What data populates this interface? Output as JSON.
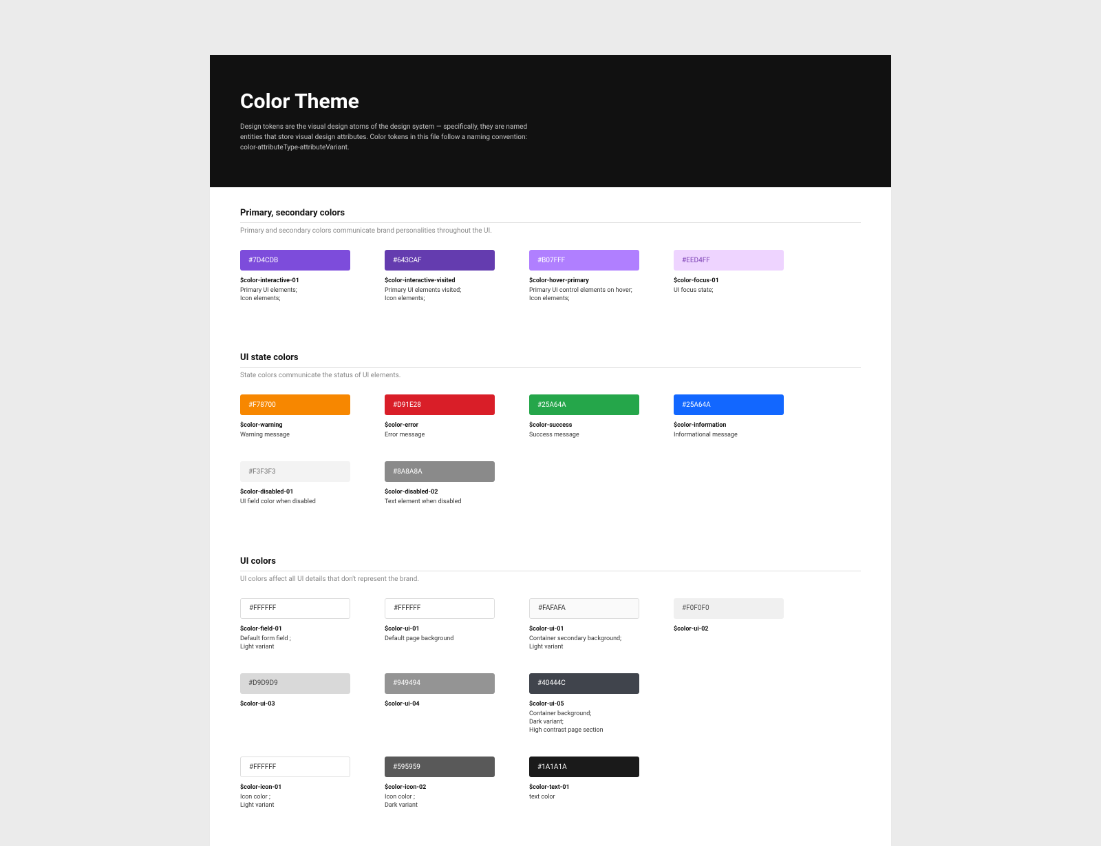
{
  "header": {
    "title": "Color Theme",
    "subtitle": "Design tokens are the visual design atoms of the design system — specifically, they are named entities that store visual design attributes. Color tokens in this file follow a naming convention: color-attributeType-attributeVariant."
  },
  "sections": [
    {
      "title": "Primary, secondary colors",
      "subtitle": "Primary and secondary colors communicate brand personalities throughout the UI.",
      "swatches": [
        {
          "hex": "#7D4CDB",
          "bg": "#7D4CDB",
          "txt": "#ffffff",
          "name": "$color-interactive-01",
          "desc": "Primary UI elements;\nIcon elements;"
        },
        {
          "hex": "#643CAF",
          "bg": "#643CAF",
          "txt": "#ffffff",
          "name": "$color-interactive-visited",
          "desc": "Primary UI elements visited;\nIcon elements;"
        },
        {
          "hex": "#B07FFF",
          "bg": "#B07FFF",
          "txt": "#ffffff",
          "name": "$color-hover-primary",
          "desc": "Primary UI control elements on hover;\nIcon elements;"
        },
        {
          "hex": "#EED4FF",
          "bg": "#EED4FF",
          "txt": "#7a3fb3",
          "name": "$color-focus-01",
          "desc": "UI focus state;"
        }
      ]
    },
    {
      "title": "UI state colors",
      "subtitle": "State colors communicate the status of UI elements.",
      "swatches": [
        {
          "hex": "#F78700",
          "bg": "#F78700",
          "txt": "#ffffff",
          "name": "$color-warning",
          "desc": "Warning message"
        },
        {
          "hex": "#D91E28",
          "bg": "#D91E28",
          "txt": "#ffffff",
          "name": "$color-error",
          "desc": "Error message"
        },
        {
          "hex": "#25A64A",
          "bg": "#25A64A",
          "txt": "#ffffff",
          "name": "$color-success",
          "desc": "Success message"
        },
        {
          "hex": "#25A64A",
          "bg": "#1267ff",
          "txt": "#ffffff",
          "name": "$color-information",
          "desc": "Informational message"
        },
        {
          "hex": "#F3F3F3",
          "bg": "#F3F3F3",
          "txt": "#777777",
          "name": "$color-disabled-01",
          "desc": "UI field color when disabled"
        },
        {
          "hex": "#8A8A8A",
          "bg": "#8A8A8A",
          "txt": "#ffffff",
          "name": "$color-disabled-02",
          "desc": "Text element when disabled"
        }
      ]
    },
    {
      "title": "UI colors",
      "subtitle": "UI colors affect all UI details that don't represent the brand.",
      "swatches": [
        {
          "hex": "#FFFFFF",
          "bg": "#FFFFFF",
          "txt": "#333333",
          "bordered": true,
          "name": "$color-field-01",
          "desc": "Default form field ;\nLight variant"
        },
        {
          "hex": "#FFFFFF",
          "bg": "#FFFFFF",
          "txt": "#333333",
          "bordered": true,
          "name": "$color-ui-01",
          "desc": "Default page background"
        },
        {
          "hex": "#FAFAFA",
          "bg": "#FAFAFA",
          "txt": "#333333",
          "bordered": true,
          "name": "$color-ui-01",
          "desc": "Container secondary background;\nLight variant"
        },
        {
          "hex": "#F0F0F0",
          "bg": "#F0F0F0",
          "txt": "#555555",
          "name": "$color-ui-02",
          "desc": ""
        },
        {
          "hex": "#D9D9D9",
          "bg": "#D9D9D9",
          "txt": "#444444",
          "name": "$color-ui-03",
          "desc": ""
        },
        {
          "hex": "#949494",
          "bg": "#949494",
          "txt": "#ffffff",
          "name": "$color-ui-04",
          "desc": ""
        },
        {
          "hex": "#40444C",
          "bg": "#40444C",
          "txt": "#ffffff",
          "name": "$color-ui-05",
          "desc": "Container background;\nDark variant;\nHigh contrast page section"
        },
        {
          "hex": "",
          "bg": "",
          "txt": "",
          "name": "",
          "desc": "",
          "spacer": true
        },
        {
          "hex": "#FFFFFF",
          "bg": "#FFFFFF",
          "txt": "#333333",
          "bordered": true,
          "name": "$color-icon-01",
          "desc": "Icon color ;\nLight variant"
        },
        {
          "hex": "#595959",
          "bg": "#595959",
          "txt": "#ffffff",
          "name": "$color-icon-02",
          "desc": "Icon color ;\nDark variant"
        },
        {
          "hex": "#1A1A1A",
          "bg": "#1A1A1A",
          "txt": "#ffffff",
          "name": "$color-text-01",
          "desc": "text color"
        }
      ]
    }
  ]
}
